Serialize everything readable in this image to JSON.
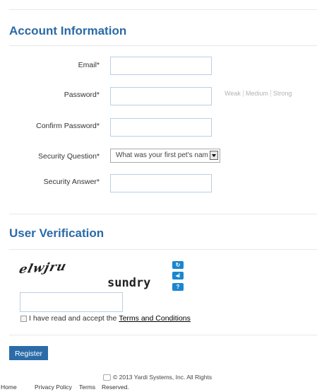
{
  "account": {
    "title": "Account Information",
    "email_label": "Email*",
    "password_label": "Password*",
    "strength": [
      "Weak",
      "Medium",
      "Strong"
    ],
    "confirm_label": "Confirm Password*",
    "question_label": "Security Question*",
    "question_value": "What was your first pet's nam",
    "answer_label": "Security Answer*"
  },
  "verification": {
    "title": "User Verification",
    "captcha_word1": "elwjru",
    "captcha_word2": "sundry",
    "captcha_icons": [
      "refresh-icon",
      "audio-icon",
      "help-icon"
    ],
    "terms_text": "I have read and accept the",
    "terms_link": "Terms and Conditions"
  },
  "register_label": "Register",
  "footer": {
    "copyright": "© 2013 Yardi Systems, Inc. All Rights",
    "links": [
      "Home",
      "Privacy Policy",
      "Terms"
    ],
    "reserved": "Reserved."
  }
}
